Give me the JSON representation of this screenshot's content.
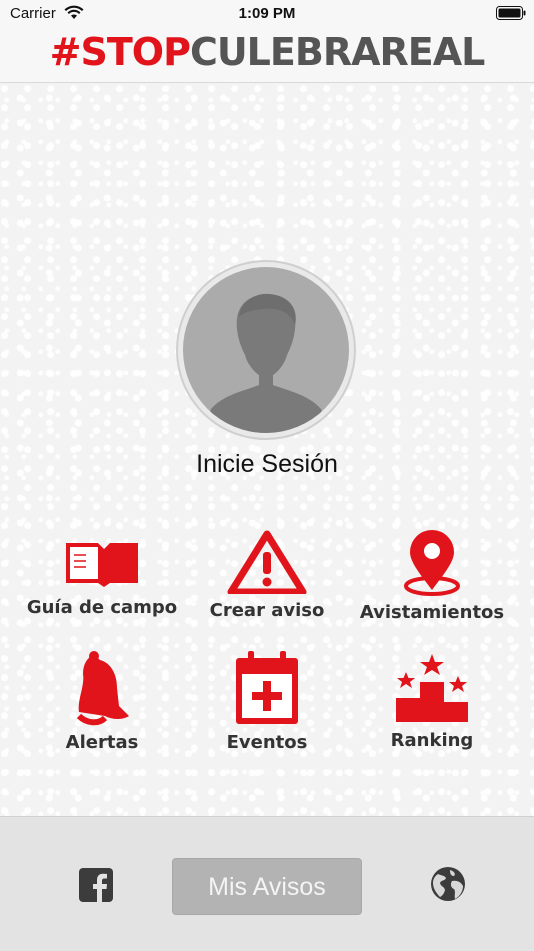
{
  "status_bar": {
    "carrier": "Carrier",
    "time": "1:09 PM"
  },
  "header": {
    "brand_red": "#STOP",
    "brand_gray": "CULEBRAREAL"
  },
  "profile": {
    "login_label": "Inicie Sesión"
  },
  "menu": [
    {
      "label": "Guía de campo",
      "icon": "book-icon"
    },
    {
      "label": "Crear aviso",
      "icon": "warning-icon"
    },
    {
      "label": "Avistamientos",
      "icon": "map-pin-icon"
    },
    {
      "label": "Alertas",
      "icon": "bell-icon"
    },
    {
      "label": "Eventos",
      "icon": "calendar-plus-icon"
    },
    {
      "label": "Ranking",
      "icon": "podium-icon"
    }
  ],
  "footer": {
    "mis_avisos_label": "Mis Avisos",
    "facebook_icon": "facebook-icon",
    "globe_icon": "globe-icon"
  },
  "colors": {
    "accent": "#e1141b",
    "brand_gray": "#555555",
    "button_disabled": "#b3b3b3"
  }
}
